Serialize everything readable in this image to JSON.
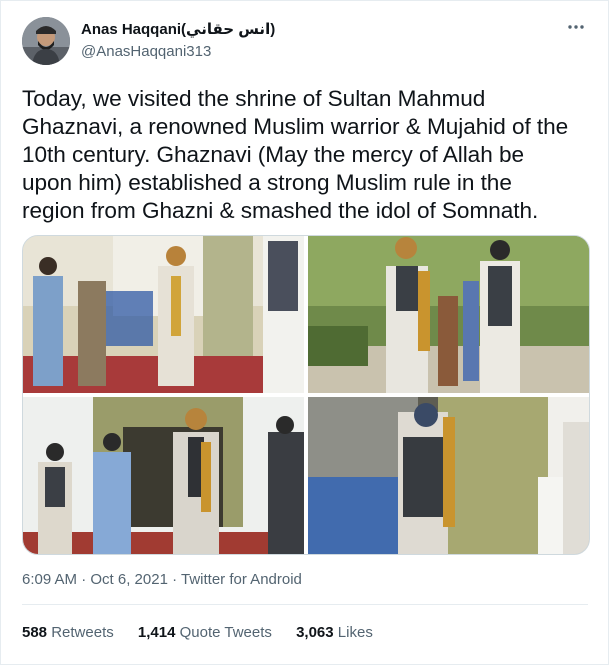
{
  "author": {
    "display_name": "Anas Haqqani(انس حقاني)",
    "handle": "@AnasHaqqani313"
  },
  "tweet": {
    "text": "Today, we visited the shrine of Sultan Mahmud\nGhaznavi, a renowned Muslim warrior & Mujahid of the\n10th century. Ghaznavi (May the mercy of Allah be\nupon him) established a strong Muslim rule in the\nregion from Ghazni & smashed the idol of Somnath.",
    "timestamp": "6:09 AM · Oct 6, 2021",
    "source": "Twitter for Android"
  },
  "stats": {
    "retweets_count": "588",
    "retweets_label": "Retweets",
    "quotes_count": "1,414",
    "quotes_label": "Quote Tweets",
    "likes_count": "3,063",
    "likes_label": "Likes"
  },
  "icons": {
    "more": "more-horizontal-icon"
  },
  "colors": {
    "text_primary": "#0f1419",
    "text_secondary": "#536471",
    "divider": "#e6ecf0"
  }
}
